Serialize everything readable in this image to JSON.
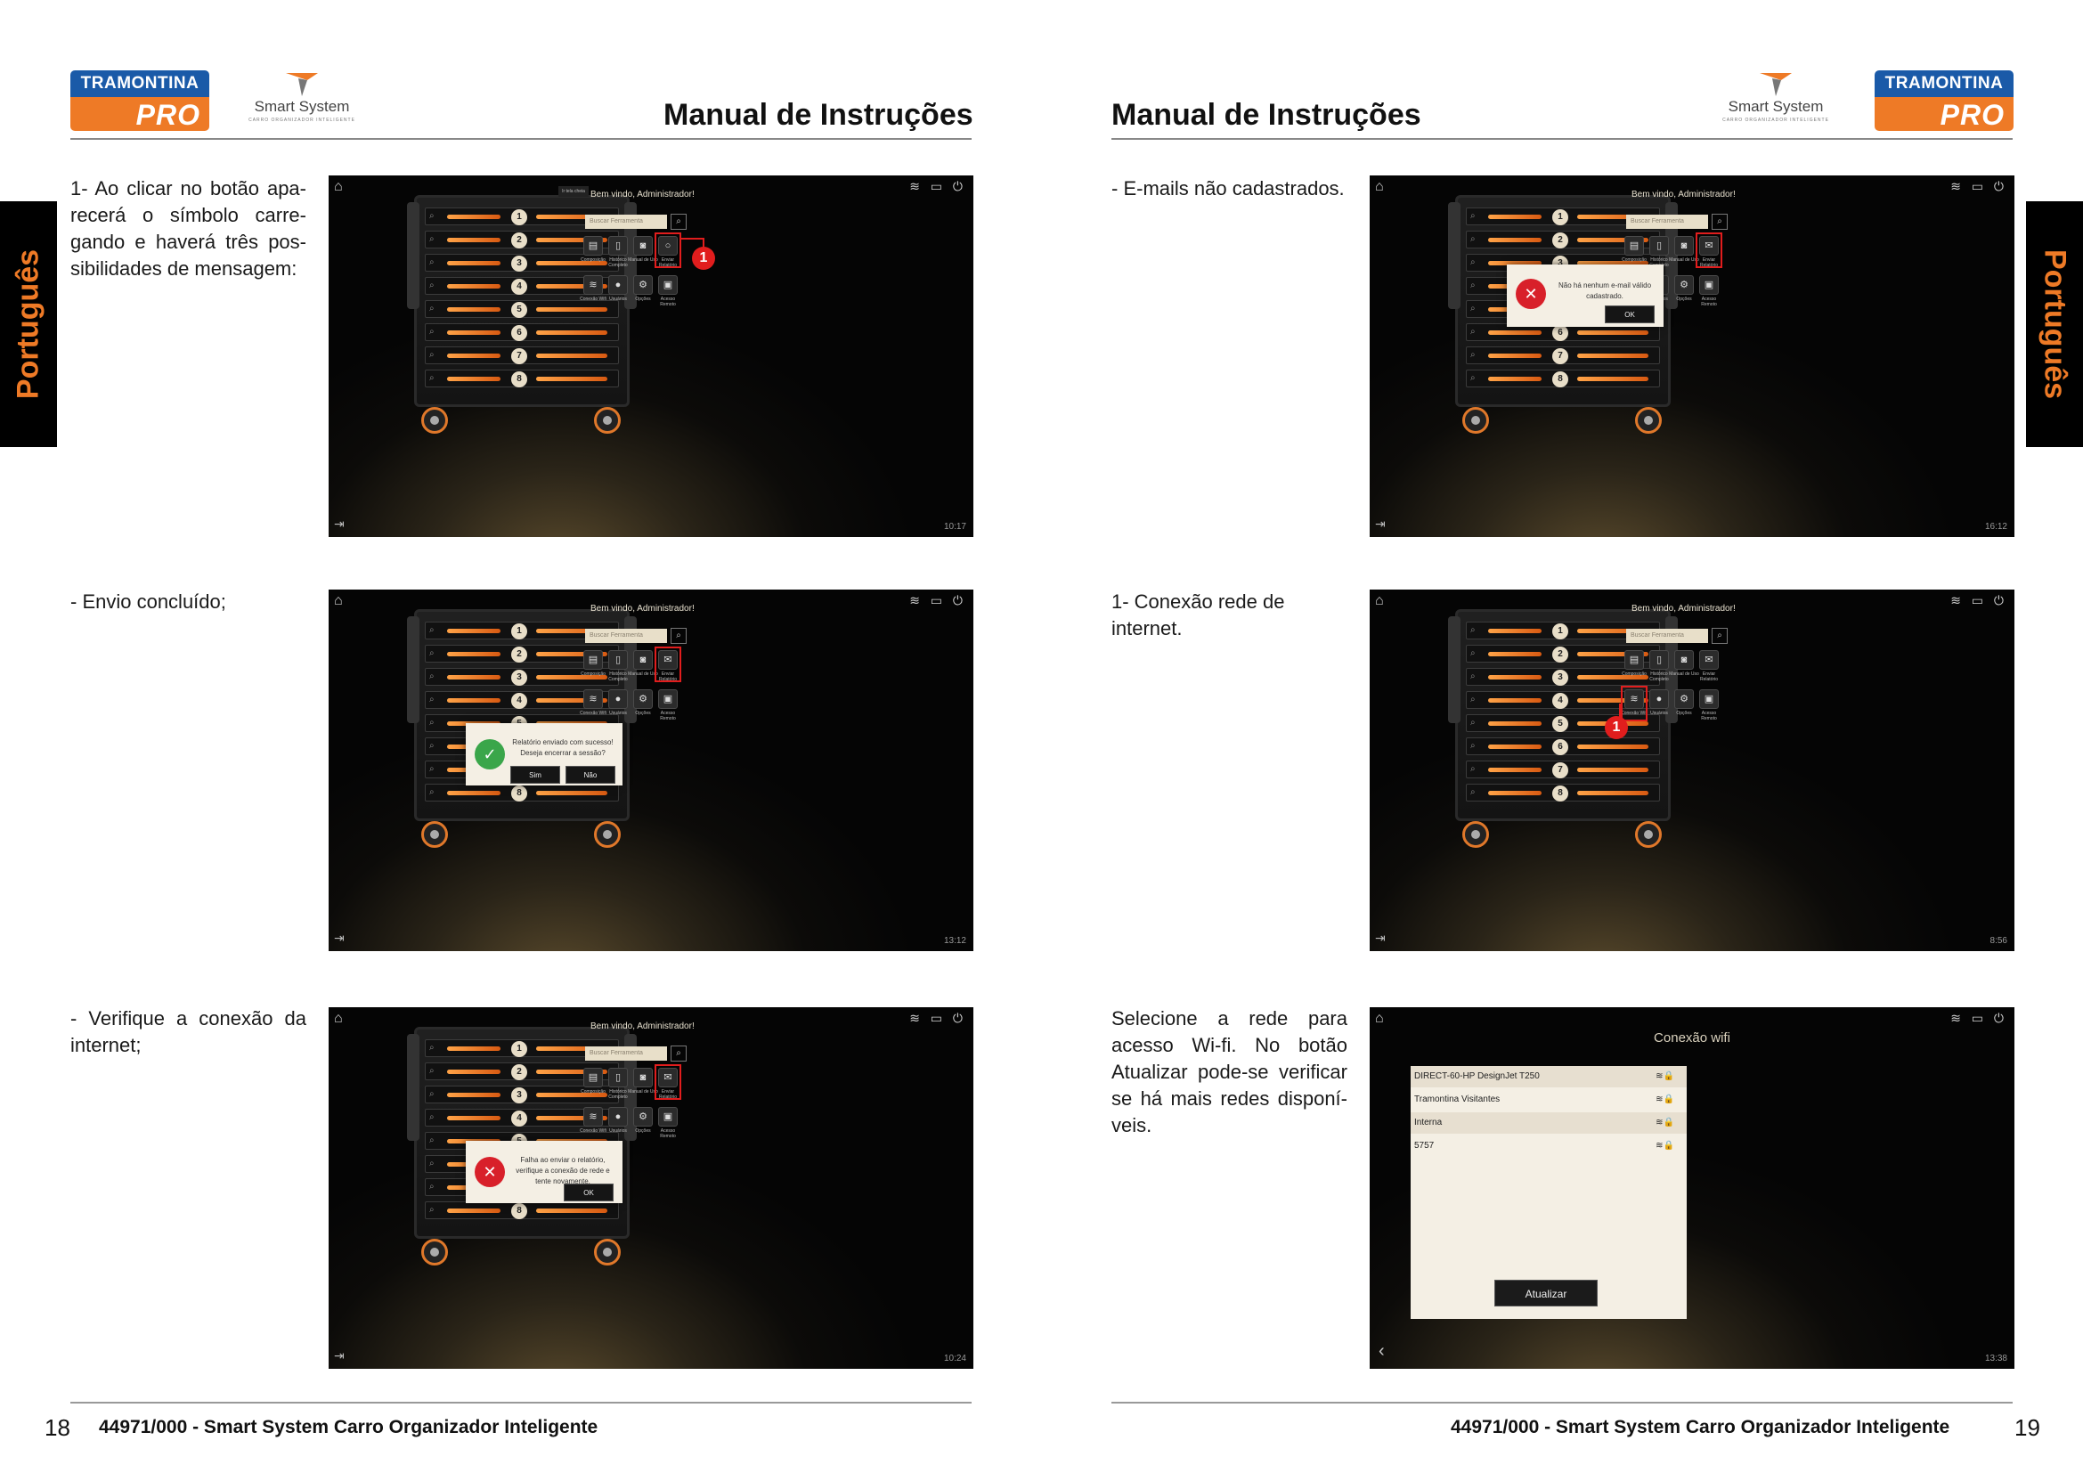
{
  "header": {
    "brand_top": "TRAMONTINA",
    "brand_bottom": "PRO",
    "smart_name": "Smart System",
    "smart_tagline": "CARRO ORGANIZADOR INTELIGENTE",
    "title": "Manual de Instruções"
  },
  "side_tab": "Português",
  "left_page": {
    "steps": [
      {
        "text": "1- Ao clicar no botão apa-recerá o símbolo carre-gando e haverá três pos-sibilidades de mensagem:"
      },
      {
        "text": "- Envio concluído;"
      },
      {
        "text": "- Verifique a conexão da internet;"
      }
    ]
  },
  "right_page": {
    "steps": [
      {
        "text": "- E-mails não cadastrados."
      },
      {
        "text": "1- Conexão rede de internet."
      },
      {
        "text": "Selecione a rede para acesso Wi-fi. No botão Atualizar pode-se verificar se há mais redes disponí-veis."
      }
    ]
  },
  "app": {
    "welcome": "Bem vindo, Administrador!",
    "search_placeholder": "Buscar Ferramenta",
    "drawer_numbers": [
      "1",
      "2",
      "3",
      "4",
      "5",
      "6",
      "7",
      "8"
    ],
    "tiles": [
      {
        "icon": "drawer-icon",
        "glyph": "▤",
        "label": "Composição"
      },
      {
        "icon": "history-icon",
        "glyph": "▯",
        "label": "Histórico Completo"
      },
      {
        "icon": "manual-icon",
        "glyph": "◙",
        "label": "Manual de Uso"
      },
      {
        "icon": "send-report-icon",
        "glyph": "✉",
        "label": "Enviar Relatório"
      },
      {
        "icon": "wifi-icon",
        "glyph": "≋",
        "label": "Conexão Wifi"
      },
      {
        "icon": "users-icon",
        "glyph": "●",
        "label": "Usuários"
      },
      {
        "icon": "options-icon",
        "glyph": "⚙",
        "label": "Opções"
      },
      {
        "icon": "remote-access-icon",
        "glyph": "▣",
        "label": "Acesso Remoto"
      }
    ],
    "tooltip": "Ir tela cheia",
    "callout": "1"
  },
  "dialogs": {
    "no_email": {
      "message": "Não há nenhum e-mail válido cadastrado.",
      "ok": "OK"
    },
    "success": {
      "message": "Relatório enviado com sucesso! Deseja encerrar a sessão?",
      "yes": "Sim",
      "no": "Não"
    },
    "fail": {
      "message": "Falha ao enviar o relatório, verifique a conexão de rede e tente novamente.",
      "ok": "OK"
    }
  },
  "wifi_screen": {
    "title": "Conexão wifi",
    "networks": [
      "DIRECT-60-HP DesignJet T250",
      "Tramontina Visitantes",
      "Interna",
      "5757"
    ],
    "update_button": "Atualizar"
  },
  "times": {
    "s1": "10:17",
    "s2": "13:12",
    "s3": "10:24",
    "s4": "16:12",
    "s5": "8:56",
    "s6": "13:38"
  },
  "footer": {
    "left_page_number": "18",
    "right_page_number": "19",
    "title": "44971/000 - Smart System Carro Organizador Inteligente"
  },
  "colors": {
    "brand_blue": "#1a5aa8",
    "brand_orange": "#ee7a26",
    "highlight_red": "#e11d1d",
    "success_green": "#3aa64a",
    "error_red": "#d8202a"
  }
}
